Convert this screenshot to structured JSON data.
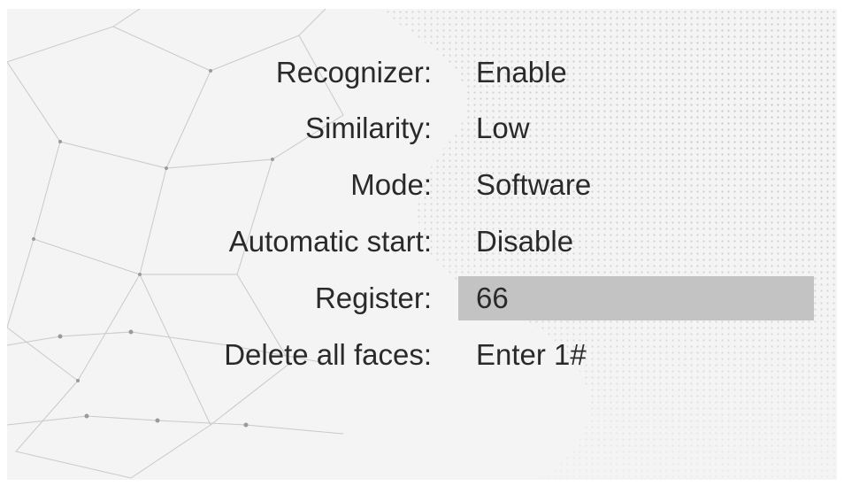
{
  "settings": {
    "rows": [
      {
        "label": "Recognizer:",
        "value": "Enable"
      },
      {
        "label": "Similarity:",
        "value": "Low"
      },
      {
        "label": "Mode:",
        "value": "Software"
      },
      {
        "label": "Automatic start:",
        "value": "Disable"
      },
      {
        "label": "Register:",
        "value": "66",
        "selected": true
      },
      {
        "label": "Delete all faces:",
        "value": "Enter 1#"
      }
    ]
  },
  "theme": {
    "background": "#f3f3f3",
    "text": "#2a2a2a",
    "highlight": "#c3c3c3"
  }
}
